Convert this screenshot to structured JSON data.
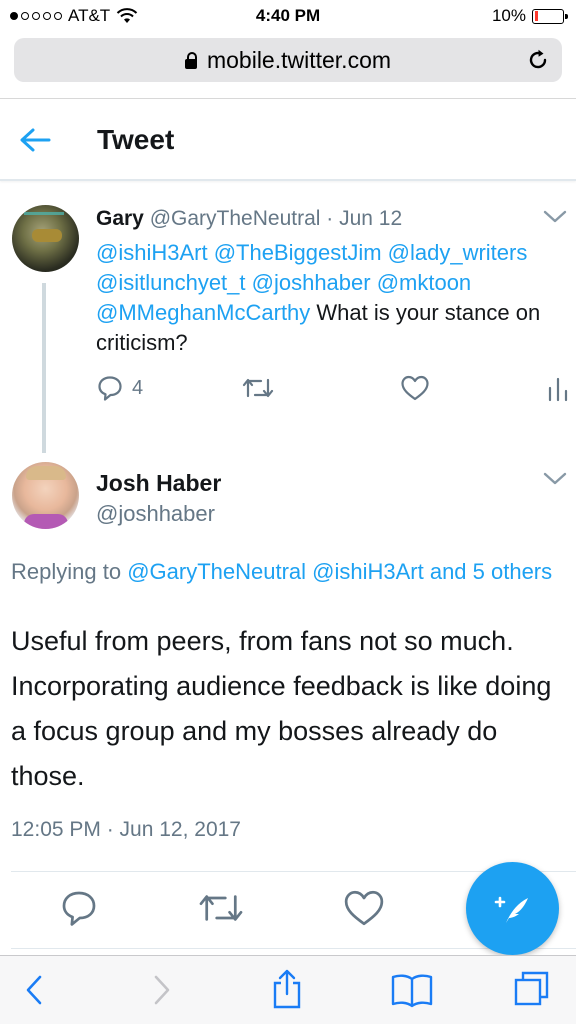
{
  "status_bar": {
    "carrier": "AT&T",
    "time": "4:40 PM",
    "battery": "10%",
    "signal_bars_filled": 1,
    "signal_bars_total": 5,
    "battery_level": 0.1
  },
  "browser": {
    "url": "mobile.twitter.com"
  },
  "header": {
    "title": "Tweet"
  },
  "parent_tweet": {
    "name": "Gary",
    "handle": "@GaryTheNeutral",
    "date": "· Jun 12",
    "mentions": "@ishiH3Art @TheBiggestJim @lady_writers @isitlunchyet_t @joshhaber @mktoon @MMeghanMcCarthy",
    "text": " What is your stance on criticism?",
    "reply_count": "4"
  },
  "main_tweet": {
    "name": "Josh Haber",
    "handle": "@joshhaber",
    "replying_prefix": "Replying to ",
    "replying_to": "@GaryTheNeutral @ishiH3Art and 5 others",
    "text": "Useful from peers, from fans not so much. Incorporating audience feedback is like doing a focus group and my bosses already do those.",
    "timestamp": "12:05 PM · Jun 12, 2017"
  },
  "colors": {
    "accent": "#1da1f2",
    "secondary_text": "#657786",
    "primary_text": "#14171a"
  }
}
